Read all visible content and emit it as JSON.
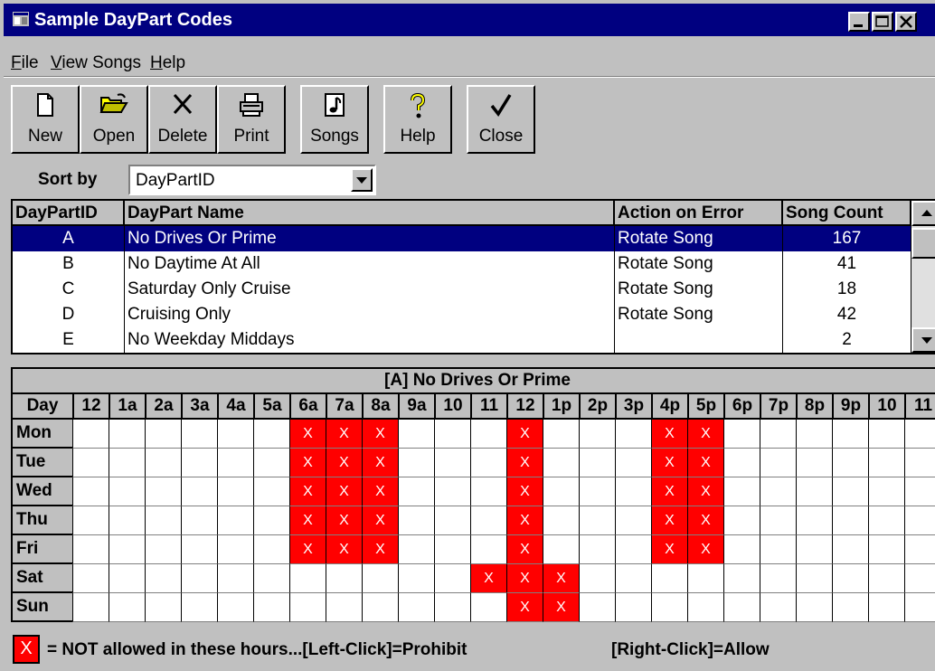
{
  "window": {
    "title": "Sample DayPart Codes"
  },
  "menu": [
    {
      "label": "File",
      "ul": "F",
      "rest": "ile"
    },
    {
      "label": "View Songs",
      "ul": "V",
      "rest": "iew Songs"
    },
    {
      "label": "Help",
      "ul": "H",
      "rest": "elp"
    }
  ],
  "toolbar": {
    "new": "New",
    "open": "Open",
    "delete": "Delete",
    "print": "Print",
    "songs": "Songs",
    "help": "Help",
    "close": "Close"
  },
  "sort": {
    "label": "Sort by",
    "value": "DayPartID"
  },
  "grid": {
    "headers": [
      "DayPartID",
      "DayPart Name",
      "Action on Error",
      "Song Count"
    ],
    "selected_row": 0,
    "rows": [
      {
        "id": "A",
        "name": "No Drives Or Prime",
        "action": "Rotate Song",
        "count": "167"
      },
      {
        "id": "B",
        "name": "No Daytime At All",
        "action": "Rotate Song",
        "count": "41"
      },
      {
        "id": "C",
        "name": "Saturday Only Cruise",
        "action": "Rotate Song",
        "count": "18"
      },
      {
        "id": "D",
        "name": "Cruising Only",
        "action": "Rotate Song",
        "count": "42"
      },
      {
        "id": "E",
        "name": "No Weekday Middays",
        "action": "",
        "count": "2"
      }
    ]
  },
  "schedule": {
    "title": "[A] No Drives Or Prime",
    "day_header": "Day",
    "hours": [
      "12",
      "1a",
      "2a",
      "3a",
      "4a",
      "5a",
      "6a",
      "7a",
      "8a",
      "9a",
      "10",
      "11",
      "12",
      "1p",
      "2p",
      "3p",
      "4p",
      "5p",
      "6p",
      "7p",
      "8p",
      "9p",
      "10",
      "11"
    ],
    "days": [
      {
        "label": "Mon",
        "blocked": [
          6,
          7,
          8,
          12,
          16,
          17
        ]
      },
      {
        "label": "Tue",
        "blocked": [
          6,
          7,
          8,
          12,
          16,
          17
        ]
      },
      {
        "label": "Wed",
        "blocked": [
          6,
          7,
          8,
          12,
          16,
          17
        ]
      },
      {
        "label": "Thu",
        "blocked": [
          6,
          7,
          8,
          12,
          16,
          17
        ]
      },
      {
        "label": "Fri",
        "blocked": [
          6,
          7,
          8,
          12,
          16,
          17
        ]
      },
      {
        "label": "Sat",
        "blocked": [
          11,
          12,
          13
        ]
      },
      {
        "label": "Sun",
        "blocked": [
          12,
          13
        ]
      }
    ],
    "mark": "X",
    "blocked_color": "#ff0000"
  },
  "legend": {
    "mark": "X",
    "text": "= NOT allowed in these hours...[Left-Click]=Prohibit",
    "right": "[Right-Click]=Allow"
  }
}
